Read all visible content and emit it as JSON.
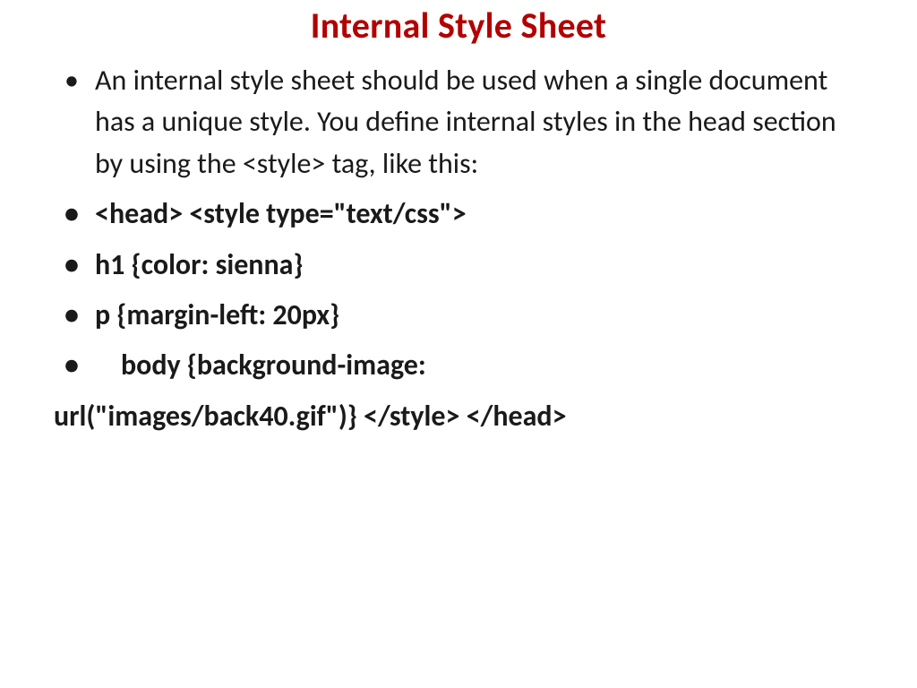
{
  "title": "Internal Style Sheet",
  "bullets": {
    "b1": "An internal style sheet should be used when a single document has a unique style. You define internal styles in the head section by using the <style> tag, like this:",
    "b2": "<head> <style type=\"text/css\">",
    "b3": "h1 {color: sienna}",
    "b4": "p {margin-left: 20px}",
    "b5": "    body {background-image:"
  },
  "trailing": "url(\"images/back40.gif\")} </style> </head>"
}
